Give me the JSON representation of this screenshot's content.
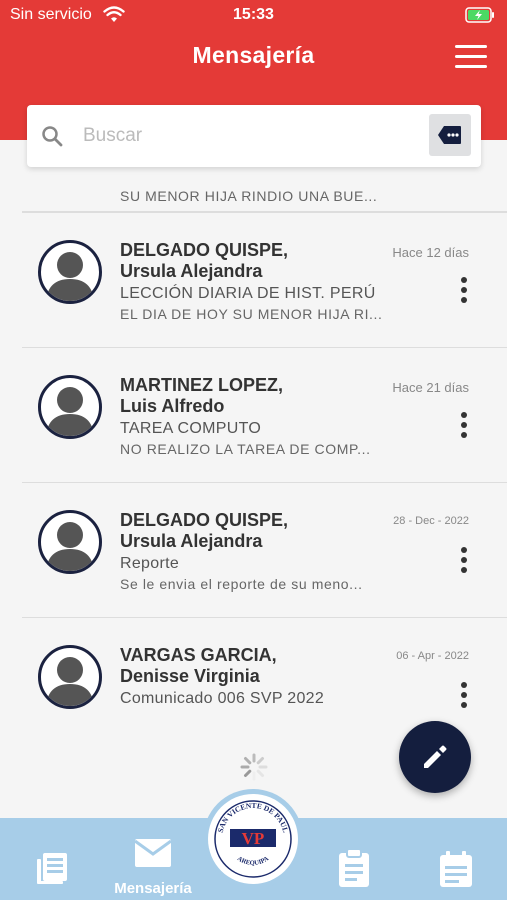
{
  "status": {
    "carrier": "Sin servicio",
    "time": "15:33"
  },
  "header": {
    "title": "Mensajería"
  },
  "search": {
    "placeholder": "Buscar",
    "value": ""
  },
  "messages": [
    {
      "last_name": "",
      "first_name": "",
      "subject": "",
      "preview": "SU MENOR HIJA RINDIO UNA BUE...",
      "date": ""
    },
    {
      "last_name": "DELGADO QUISPE,",
      "first_name": "Ursula Alejandra",
      "subject": "LECCIÓN DIARIA DE HIST. PERÚ",
      "preview": "EL DIA DE HOY SU MENOR HIJA RI...",
      "date": "Hace 12 días"
    },
    {
      "last_name": "MARTINEZ LOPEZ,",
      "first_name": "Luis Alfredo",
      "subject": "TAREA COMPUTO",
      "preview": "NO REALIZO LA TAREA DE COMP...",
      "date": "Hace 21 días"
    },
    {
      "last_name": "DELGADO QUISPE,",
      "first_name": "Ursula Alejandra",
      "subject": "Reporte",
      "preview": "Se le envia el reporte de su meno...",
      "date": "28 - Dec - 2022"
    },
    {
      "last_name": "VARGAS GARCIA,",
      "first_name": "Denisse Virginia",
      "subject": "Comunicado 006 SVP 2022",
      "preview": "",
      "date": "06 - Apr - 2022"
    }
  ],
  "bottom_nav": {
    "active_label": "Mensajería"
  },
  "logo": {
    "top_text": "SAN VICENTE DE PAUL",
    "initials": "VP",
    "bottom_text": "AREQUIPA"
  },
  "colors": {
    "header": "#e43a37",
    "accent_dark": "#141e3e",
    "bottom_nav": "#a7cde8"
  }
}
